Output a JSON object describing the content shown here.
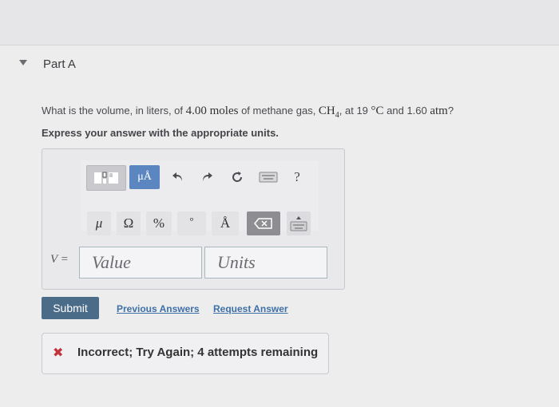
{
  "part": {
    "title": "Part A"
  },
  "question": {
    "text_prefix": "What is the volume, in liters, of ",
    "amount": "4.00 moles",
    "text_mid": " of methane gas, ",
    "formula_base": "CH",
    "formula_sub": "4",
    "text_at": ", at 19 ",
    "temp_unit": "°C",
    "text_and": " and 1.60 ",
    "pressure_unit": "atm",
    "text_end": "?"
  },
  "instruction": "Express your answer with the appropriate units.",
  "toolbar": {
    "unit_button": "μÅ",
    "help": "?",
    "symbols": [
      "μ",
      "Ω",
      "%",
      "°",
      "Å"
    ]
  },
  "answer": {
    "variable_label": "V =",
    "value_placeholder": "Value",
    "units_placeholder": "Units"
  },
  "actions": {
    "submit": "Submit",
    "previous_answers": "Previous Answers",
    "request_answer": "Request Answer"
  },
  "feedback": {
    "text": "Incorrect; Try Again; 4 attempts remaining"
  },
  "colors": {
    "submit_bg": "#4b6c88",
    "link": "#3e6fa7",
    "error_icon": "#c1323a",
    "unit_button_bg": "#5b86c0"
  }
}
